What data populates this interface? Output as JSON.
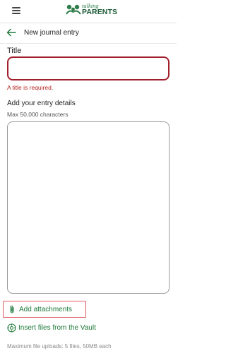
{
  "header": {
    "menu_icon": "hamburger-menu-icon",
    "logo_talking": "talking",
    "logo_parents": "PARENTS",
    "brand_color": "#1c5a36"
  },
  "nav": {
    "back_icon": "arrow-left-icon",
    "title": "New journal entry"
  },
  "form": {
    "title_label": "Title",
    "title_value": "",
    "title_error": "A title is required.",
    "entry_label": "Add your entry details",
    "entry_hint": "Max 50,000 characters",
    "entry_value": ""
  },
  "attachments": {
    "add_label": "Add attachments",
    "add_icon": "paperclip-icon",
    "vault_label": "Insert files from the Vault",
    "vault_icon": "vault-icon",
    "upload_note": "Maximum file uploads: 5 files, 50MB each"
  },
  "colors": {
    "accent_green": "#1f7a3a",
    "error_red": "#a01f2b"
  }
}
